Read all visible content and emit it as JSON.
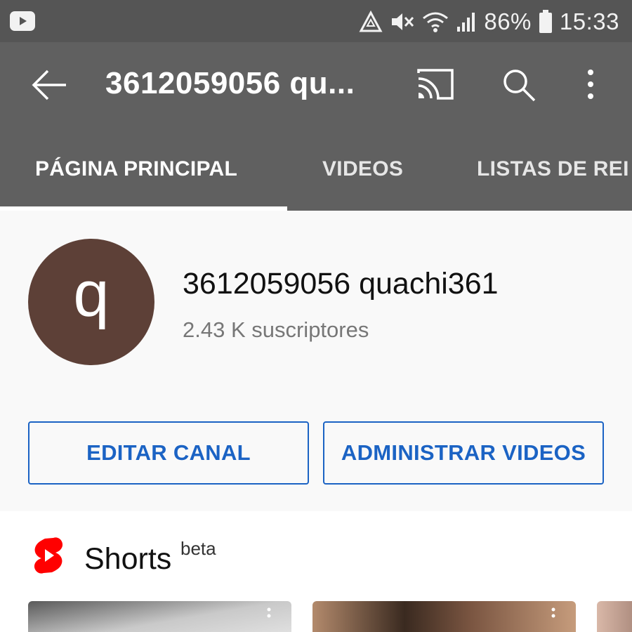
{
  "status_bar": {
    "battery": "86%",
    "time": "15:33"
  },
  "app_bar": {
    "title": "3612059056 qu..."
  },
  "tabs": [
    {
      "label": "PÁGINA PRINCIPAL",
      "active": true
    },
    {
      "label": "VIDEOS",
      "active": false
    },
    {
      "label": "LISTAS DE REI",
      "active": false
    }
  ],
  "channel": {
    "avatar_letter": "q",
    "avatar_color": "#5d4037",
    "name": "3612059056 quachi361",
    "subscribers": "2.43 K suscriptores"
  },
  "buttons": {
    "edit": "EDITAR CANAL",
    "manage": "ADMINISTRAR VIDEOS"
  },
  "shorts": {
    "title": "Shorts",
    "badge": "beta",
    "accent": "#ff0000"
  },
  "colors": {
    "status_bar": "#555555",
    "app_bar": "#606060",
    "link_blue": "#1b63c4"
  }
}
